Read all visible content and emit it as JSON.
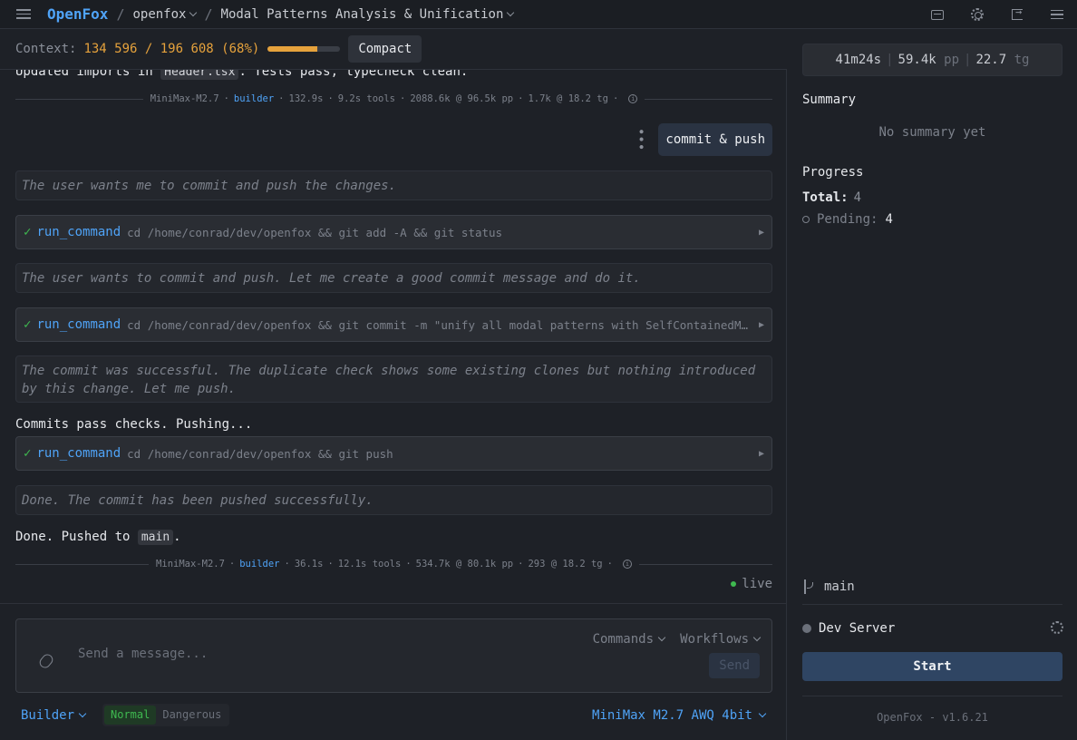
{
  "topbar": {
    "brand": "OpenFox",
    "sep1": "/",
    "project": "openfox",
    "sep2": "/",
    "session": "Modal Patterns Analysis & Unification"
  },
  "context": {
    "label": "Context:",
    "value": "134 596 / 196 608 (68%)",
    "fill_fraction": 0.68,
    "compact_label": "Compact"
  },
  "chat": {
    "top_text_pre": "Updated imports in ",
    "top_text_code": "Header.tsx",
    "top_text_post": ". Tests pass, typecheck clean.",
    "meta1": {
      "model": "MiniMax-M2.7",
      "role": "builder",
      "time": "132.9s",
      "tools": "9.2s tools",
      "pp": "2088.6k @ 96.5k pp",
      "tg": "1.7k @ 18.2 tg"
    },
    "user_msg": "commit & push",
    "thought1": "The user wants me to commit and push the changes.",
    "tool1": {
      "name": "run_command",
      "cmd": "cd /home/conrad/dev/openfox && git add -A && git status"
    },
    "thought2": "The user wants to commit and push. Let me create a good commit message and do it.",
    "tool2": {
      "name": "run_command",
      "cmd": "cd /home/conrad/dev/openfox && git commit -m \"unify all modal patterns with SelfContainedModal…"
    },
    "thought3": "The commit was successful. The duplicate check shows some existing clones but nothing introduced by this change. Let me push.",
    "plain1": "Commits pass checks. Pushing...",
    "tool3": {
      "name": "run_command",
      "cmd": "cd /home/conrad/dev/openfox && git push"
    },
    "thought4": "Done. The commit has been pushed successfully.",
    "done_pre": "Done. Pushed to ",
    "done_code": "main",
    "done_post": ".",
    "meta2": {
      "model": "MiniMax-M2.7",
      "role": "builder",
      "time": "36.1s",
      "tools": "12.1s tools",
      "pp": "534.7k @ 80.1k pp",
      "tg": "293 @ 18.2 tg"
    },
    "live_label": "live"
  },
  "composer": {
    "placeholder": "Send a message...",
    "commands_label": "Commands",
    "workflows_label": "Workflows",
    "send_label": "Send"
  },
  "bottom": {
    "mode": "Builder",
    "toggle_normal": "Normal",
    "toggle_dangerous": "Dangerous",
    "model": "MiniMax M2.7 AWQ 4bit"
  },
  "sidebar": {
    "stat_time": "41m24s",
    "stat_pp_value": "59.4k",
    "stat_pp_unit": "pp",
    "stat_tg_value": "22.7",
    "stat_tg_unit": "tg",
    "summary_heading": "Summary",
    "summary_empty": "No summary yet",
    "progress_heading": "Progress",
    "total_label": "Total:",
    "total_value": "4",
    "pending_label": "Pending:",
    "pending_value": "4",
    "branch": "main",
    "dev_server_label": "Dev Server",
    "start_label": "Start",
    "version": "OpenFox - v1.6.21"
  },
  "colors": {
    "accent_blue": "#4fa3f7",
    "context_amber": "#e6a23c",
    "success_green": "#3fb950"
  }
}
